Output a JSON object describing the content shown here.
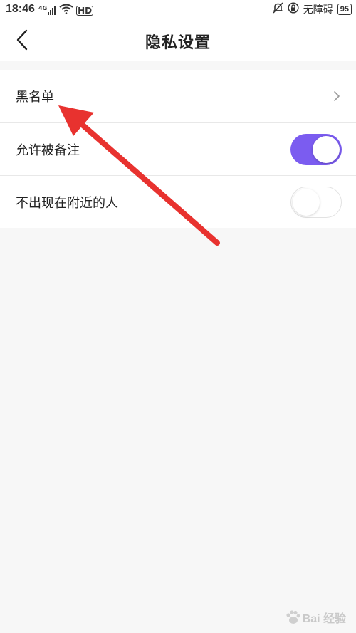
{
  "status_bar": {
    "time": "18:46",
    "network": "4G",
    "hd": "HD",
    "accessibility": "无障碍",
    "battery": "95"
  },
  "nav": {
    "title": "隐私设置"
  },
  "settings": [
    {
      "label": "黑名单",
      "control": "chevron"
    },
    {
      "label": "允许被备注",
      "control": "toggle",
      "on": true
    },
    {
      "label": "不出现在附近的人",
      "control": "toggle",
      "on": false
    }
  ],
  "colors": {
    "accent": "#7b5cf0",
    "arrow": "#e8322f",
    "background": "#f7f7f7"
  },
  "watermark": {
    "text": "Bai 经验"
  }
}
